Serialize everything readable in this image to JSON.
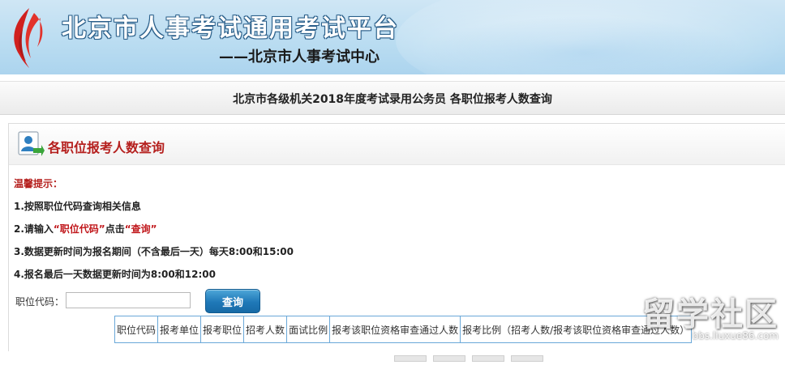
{
  "header": {
    "title": "北京市人事考试通用考试平台",
    "subtitle": "——北京市人事考试中心"
  },
  "topbar": {
    "text": "北京市各级机关2018年度考试录用公务员   各职位报考人数查询"
  },
  "panel": {
    "title": "各职位报考人数查询"
  },
  "tips": {
    "heading": "温馨提示：",
    "line1": "1.按照职位代码查询相关信息",
    "line2_prefix": "2.请输入",
    "line2_code": "“职位代码”",
    "line2_mid": "点击",
    "line2_query": "“查询”",
    "line3": "3.数据更新时间为报名期间（不含最后一天）每天8:00和15:00",
    "line4": "4.报名最后一天数据更新时间为8:00和12:00"
  },
  "form": {
    "label": "职位代码：",
    "value": "",
    "placeholder": "",
    "button": "查询"
  },
  "table": {
    "headers": [
      "职位代码",
      "报考单位",
      "报考职位",
      "招考人数",
      "面试比例",
      "报考该职位资格审查通过人数",
      "报考比例（招考人数/报考该职位资格审查通过人数）"
    ]
  },
  "watermark": {
    "brand": "留学社区",
    "url": "bbs.liuxue86.com"
  },
  "colors": {
    "accent_red": "#b5201e",
    "button_blue": "#1f78b8",
    "table_border": "#6aa8d8"
  }
}
